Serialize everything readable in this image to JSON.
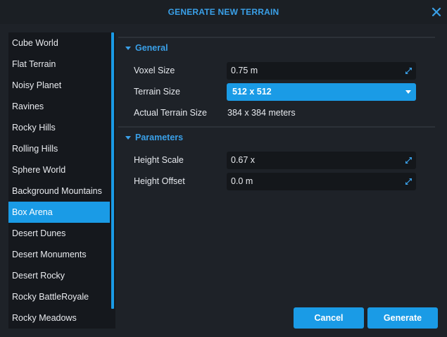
{
  "dialog": {
    "title": "GENERATE NEW TERRAIN",
    "accent_color": "#1a9be6",
    "close_icon": "close-x"
  },
  "templates": {
    "selected": "Box Arena",
    "items": [
      "Cube World",
      "Flat Terrain",
      "Noisy Planet",
      "Ravines",
      "Rocky Hills",
      "Rolling Hills",
      "Sphere World",
      "Background Mountains",
      "Box Arena",
      "Desert Dunes",
      "Desert Monuments",
      "Desert Rocky",
      "Rocky BattleRoyale",
      "Rocky Meadows"
    ]
  },
  "general": {
    "header": "General",
    "voxel_size_label": "Voxel Size",
    "voxel_size_value": "0.75 m",
    "terrain_size_label": "Terrain Size",
    "terrain_size_value": "512 x 512",
    "actual_size_label": "Actual Terrain Size",
    "actual_size_value": "384 x 384 meters"
  },
  "parameters": {
    "header": "Parameters",
    "height_scale_label": "Height Scale",
    "height_scale_value": "0.67 x",
    "height_offset_label": "Height Offset",
    "height_offset_value": "0.0 m"
  },
  "buttons": {
    "cancel": "Cancel",
    "generate": "Generate"
  }
}
